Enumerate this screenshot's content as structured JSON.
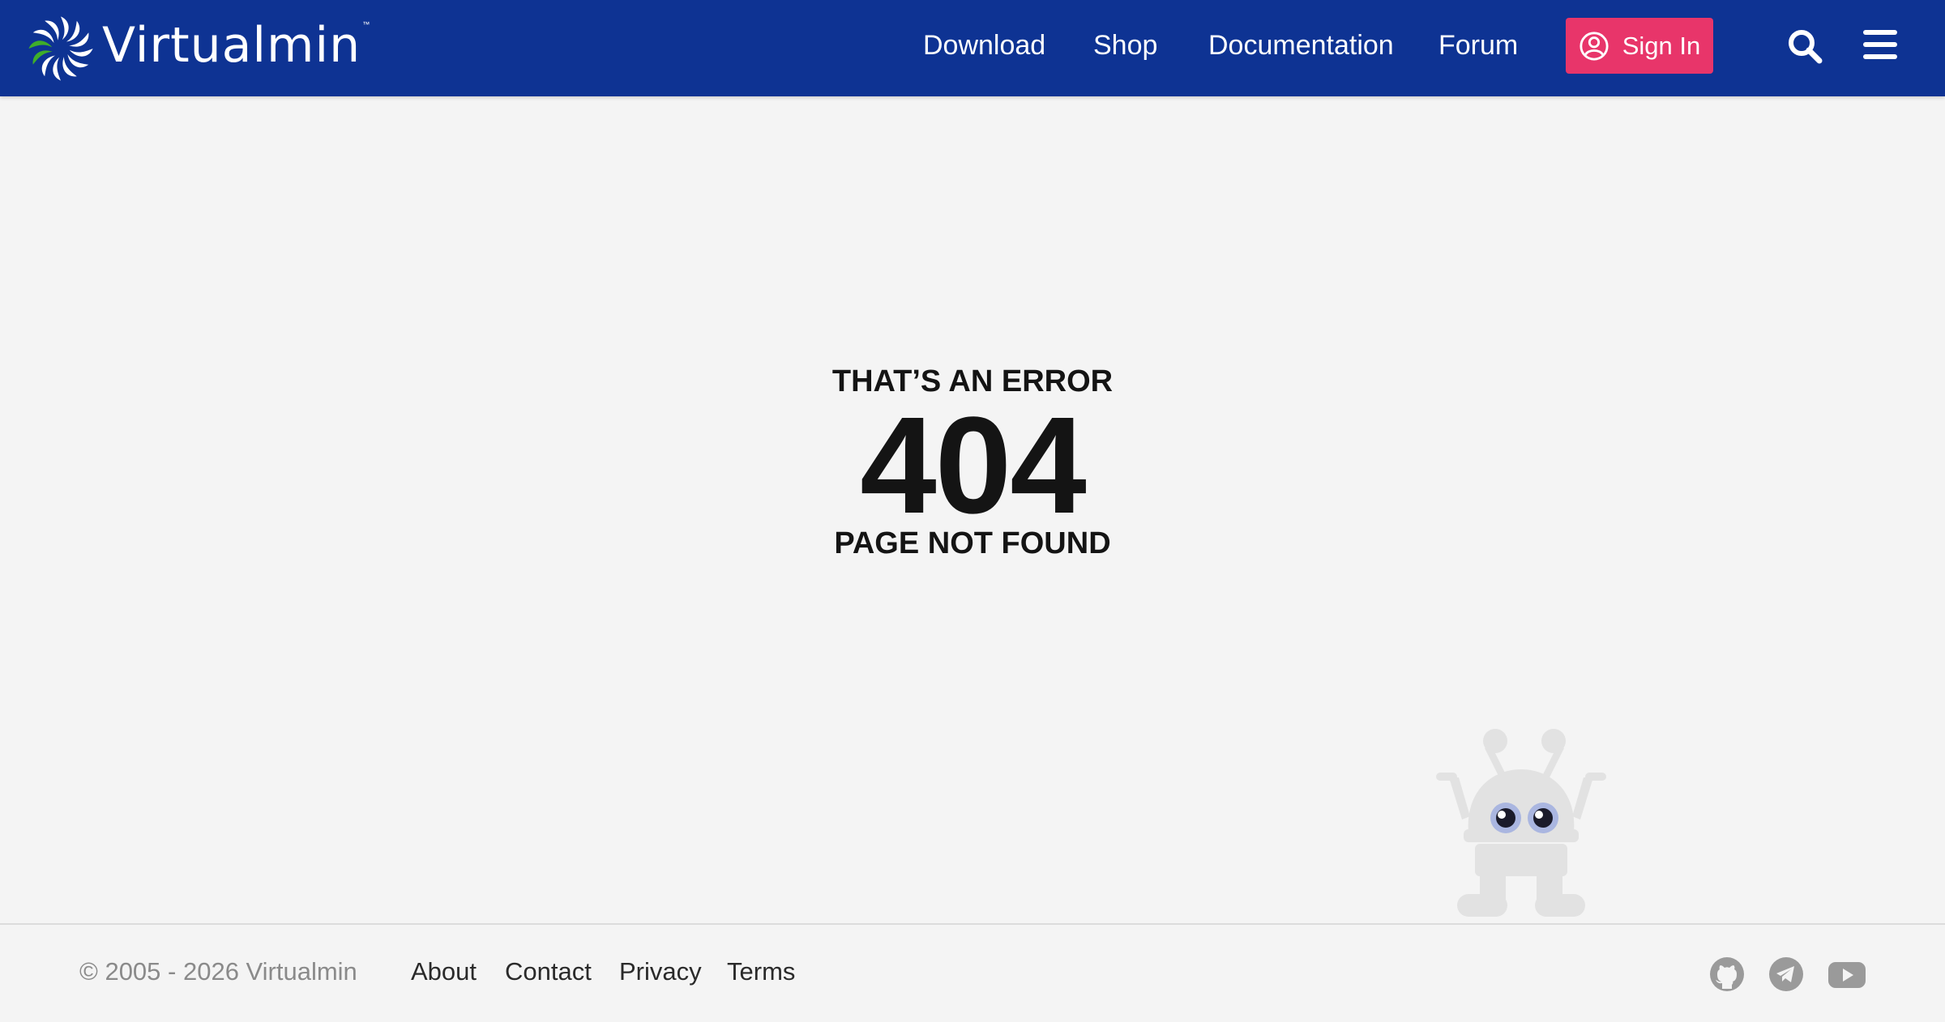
{
  "header": {
    "brand": "Virtualmin",
    "trademark": "™",
    "nav": [
      "Download",
      "Shop",
      "Documentation",
      "Forum"
    ],
    "signin_label": "Sign In",
    "colors": {
      "background": "#0e3393",
      "signin": "#e8356a"
    }
  },
  "error": {
    "top": "THAT’S AN ERROR",
    "code": "404",
    "bottom": "PAGE NOT FOUND"
  },
  "footer": {
    "copyright": "© 2005 - 2026 Virtualmin",
    "links": [
      "About",
      "Contact",
      "Privacy",
      "Terms"
    ],
    "social_icons": [
      "github-icon",
      "telegram-icon",
      "youtube-icon"
    ]
  }
}
